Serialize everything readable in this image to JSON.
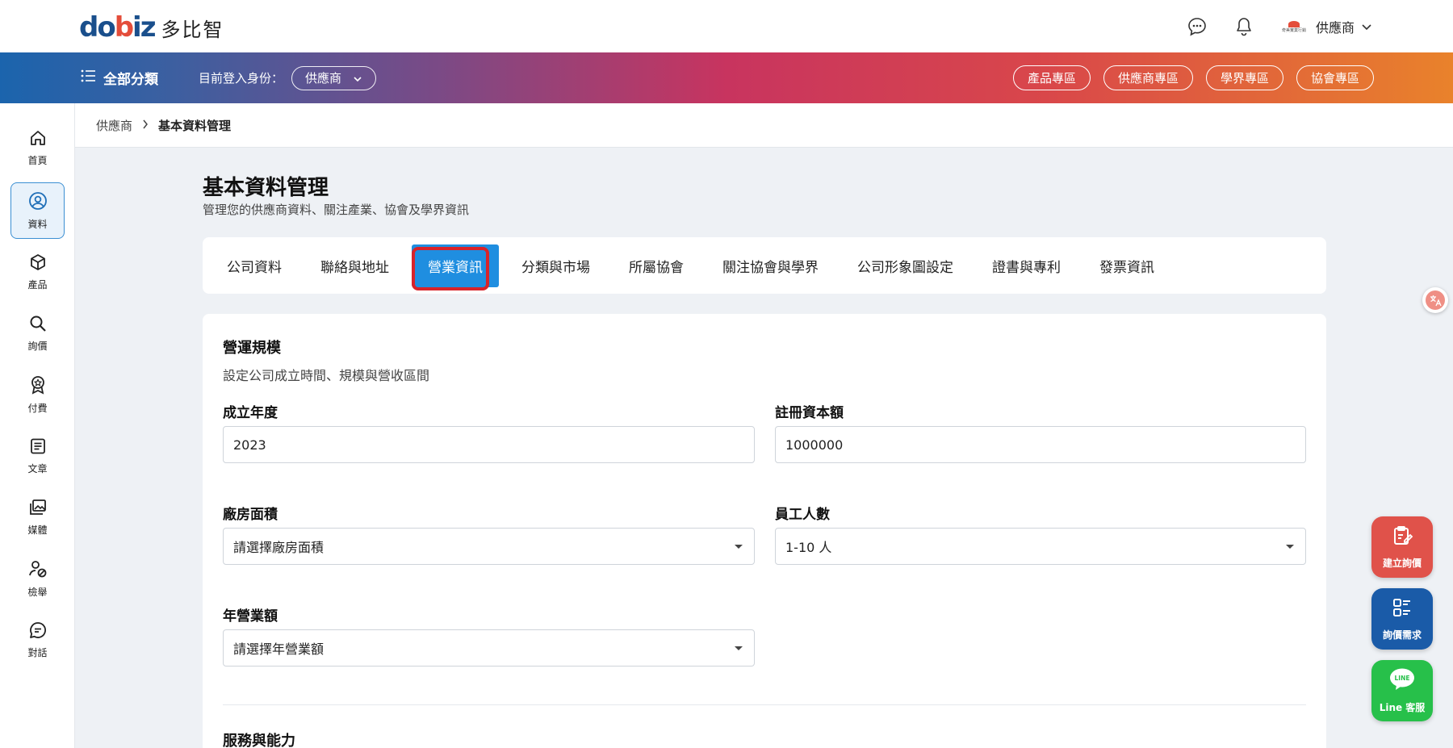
{
  "header": {
    "logo_mark": "dobiz",
    "logo_text": "多比智",
    "user_brand_text": "奇美實業行銷",
    "user_role": "供應商"
  },
  "navbar": {
    "all_categories": "全部分類",
    "identity_label": "目前登入身份：",
    "identity_value": "供應商",
    "zones": [
      "產品專區",
      "供應商專區",
      "學界專區",
      "協會專區"
    ]
  },
  "sidebar": {
    "items": [
      {
        "label": "首頁",
        "icon": "home-icon"
      },
      {
        "label": "資料",
        "icon": "user-circle-icon",
        "active": true
      },
      {
        "label": "產品",
        "icon": "box-icon"
      },
      {
        "label": "詢價",
        "icon": "search-icon"
      },
      {
        "label": "付費",
        "icon": "award-icon"
      },
      {
        "label": "文章",
        "icon": "document-icon"
      },
      {
        "label": "媒體",
        "icon": "media-icon"
      },
      {
        "label": "檢舉",
        "icon": "report-user-icon"
      },
      {
        "label": "對話",
        "icon": "chat-icon"
      }
    ]
  },
  "breadcrumb": {
    "parent": "供應商",
    "current": "基本資料管理"
  },
  "page": {
    "title": "基本資料管理",
    "subtitle": "管理您的供應商資料、關注產業、協會及學界資訊"
  },
  "tabs": [
    "公司資料",
    "聯絡與地址",
    "營業資訊",
    "分類與市場",
    "所屬協會",
    "關注協會與學界",
    "公司形象圖設定",
    "證書與專利",
    "發票資訊"
  ],
  "active_tab": "營業資訊",
  "form": {
    "section_title": "營運規模",
    "section_subtitle": "設定公司成立時間、規模與營收區間",
    "fields": {
      "founded_year": {
        "label": "成立年度",
        "value": "2023"
      },
      "registered_capital": {
        "label": "註冊資本額",
        "value": "1000000"
      },
      "factory_area": {
        "label": "廠房面積",
        "placeholder": "請選擇廠房面積"
      },
      "employee_count": {
        "label": "員工人數",
        "value": "1-10 人"
      },
      "annual_revenue": {
        "label": "年營業額",
        "placeholder": "請選擇年營業額"
      }
    },
    "next_section_title": "服務與能力"
  },
  "floating": {
    "create_inquiry": "建立詢價",
    "inquiry_demand": "詢價需求",
    "line_service": "Line 客服",
    "line_badge": "LINE"
  },
  "colors": {
    "accent": "#1f8ee0",
    "highlight_outline": "#d8232a",
    "fab_red": "#e0524a",
    "fab_blue": "#1a5ba8",
    "fab_green": "#27c04a"
  }
}
